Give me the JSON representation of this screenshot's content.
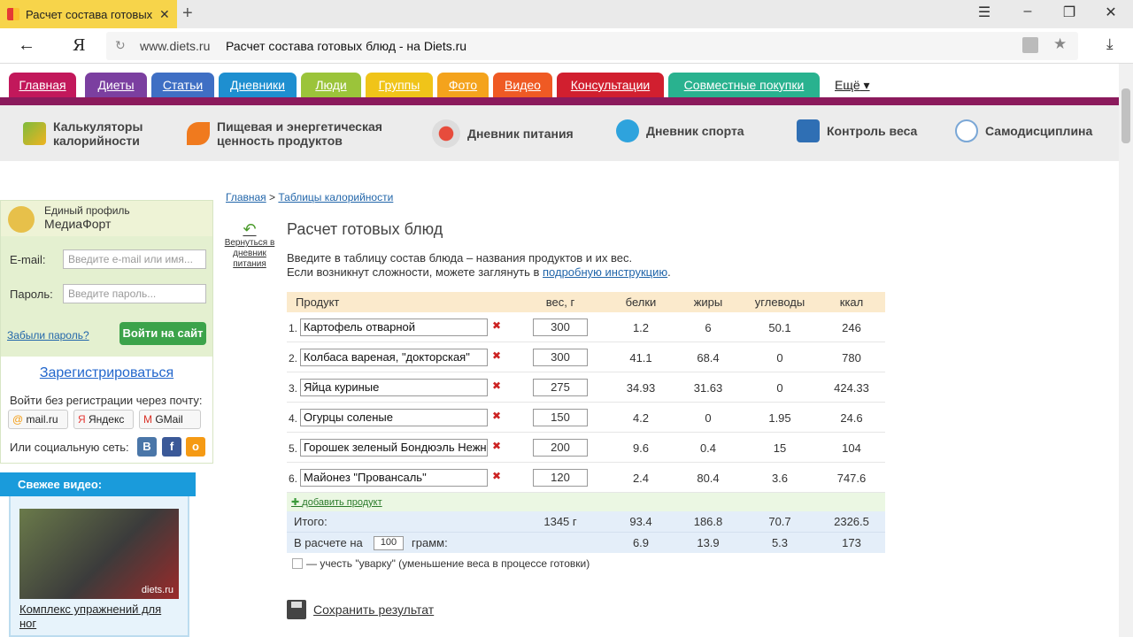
{
  "browser": {
    "tab_title": "Расчет состава готовых",
    "tab_close": "✕",
    "new_tab": "+",
    "domain": "www.diets.ru",
    "page_title": "Расчет состава готовых блюд - на Diets.ru",
    "yandex_logo": "Я"
  },
  "nav": {
    "tabs": [
      {
        "label": "Главная",
        "color": "#c2185b"
      },
      {
        "label": "Диеты",
        "color": "#7b3fa0"
      },
      {
        "label": "Статьи",
        "color": "#3f6fc4"
      },
      {
        "label": "Дневники",
        "color": "#1e8fd0"
      },
      {
        "label": "Люди",
        "color": "#9bc43a"
      },
      {
        "label": "Группы",
        "color": "#f0c419"
      },
      {
        "label": "Фото",
        "color": "#f4a31c"
      },
      {
        "label": "Видео",
        "color": "#ef5a24"
      },
      {
        "label": "Консультации",
        "color": "#d11f2f"
      },
      {
        "label": "Совместные покупки",
        "color": "#29b28f"
      }
    ],
    "more": "Ещё"
  },
  "tools": [
    {
      "label": "Калькуляторы калорийности",
      "icon": "calculator-icon"
    },
    {
      "label": "Пищевая и энергетическая ценность продуктов",
      "icon": "carrot-icon"
    },
    {
      "label": "Дневник питания",
      "icon": "plate-icon"
    },
    {
      "label": "Дневник спорта",
      "icon": "sport-icon"
    },
    {
      "label": "Контроль веса",
      "icon": "scale-icon"
    },
    {
      "label": "Самодисциплина",
      "icon": "stopwatch-icon"
    }
  ],
  "login": {
    "profile_line1": "Единый профиль",
    "profile_line2": "МедиаФорт",
    "email_label": "E-mail:",
    "email_placeholder": "Введите e-mail или имя...",
    "password_label": "Пароль:",
    "password_placeholder": "Введите пароль...",
    "forgot": "Забыли пароль?",
    "submit": "Войти на сайт",
    "register": "Зарегистрироваться",
    "no_reg": "Войти без регистрации через почту:",
    "mail_buttons": [
      "mail.ru",
      "Яндекс",
      "GMail"
    ],
    "social_label": "Или социальную сеть:",
    "social": [
      "В",
      "f",
      "о"
    ]
  },
  "video": {
    "header": "Свежее видео:",
    "watermark": "diets.ru",
    "caption": "Комплекс упражнений для ног"
  },
  "breadcrumb": {
    "home": "Главная",
    "sep": ">",
    "current": "Таблицы калорийности"
  },
  "back_link": "Вернуться в дневник питания",
  "title": "Расчет готовых блюд",
  "intro": {
    "line1": "Введите в таблицу состав блюда – названия продуктов и их вес.",
    "line2_prefix": "Если возникнут сложности, можете заглянуть в ",
    "line2_link": "подробную инструкцию",
    "line2_suffix": "."
  },
  "table": {
    "headers": {
      "product": "Продукт",
      "weight": "вес, г",
      "protein": "белки",
      "fat": "жиры",
      "carbs": "углеводы",
      "kcal": "ккал"
    },
    "rows": [
      {
        "n": "1.",
        "name": "Картофель отварной",
        "weight": "300",
        "protein": "1.2",
        "fat": "6",
        "carbs": "50.1",
        "kcal": "246"
      },
      {
        "n": "2.",
        "name": "Колбаса вареная, \"докторская\"",
        "weight": "300",
        "protein": "41.1",
        "fat": "68.4",
        "carbs": "0",
        "kcal": "780"
      },
      {
        "n": "3.",
        "name": "Яйца куриные",
        "weight": "275",
        "protein": "34.93",
        "fat": "31.63",
        "carbs": "0",
        "kcal": "424.33"
      },
      {
        "n": "4.",
        "name": "Огурцы соленые",
        "weight": "150",
        "protein": "4.2",
        "fat": "0",
        "carbs": "1.95",
        "kcal": "24.6"
      },
      {
        "n": "5.",
        "name": "Горошек зеленый Бондюэль Нежный",
        "weight": "200",
        "protein": "9.6",
        "fat": "0.4",
        "carbs": "15",
        "kcal": "104"
      },
      {
        "n": "6.",
        "name": "Майонез \"Провансаль\"",
        "weight": "120",
        "protein": "2.4",
        "fat": "80.4",
        "carbs": "3.6",
        "kcal": "747.6"
      }
    ],
    "add_product": "добавить продукт",
    "total": {
      "label": "Итого:",
      "weight": "1345 г",
      "protein": "93.4",
      "fat": "186.8",
      "carbs": "70.7",
      "kcal": "2326.5"
    },
    "per": {
      "label": "В расчете на",
      "amount": "100",
      "unit": "грамм:",
      "protein": "6.9",
      "fat": "13.9",
      "carbs": "5.3",
      "kcal": "173"
    }
  },
  "uvarka": "— учесть \"уварку\" (уменьшение веса в процессе готовки)",
  "save": "Сохранить результат"
}
